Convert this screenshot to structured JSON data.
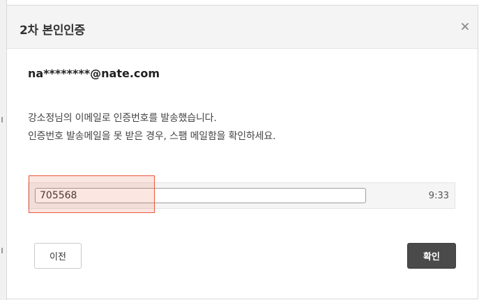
{
  "dialog": {
    "title": "2차 본인인증",
    "close_icon": "close-icon"
  },
  "account": {
    "masked_email": "na********@nate.com"
  },
  "message": {
    "line1": "강소정님의 이메일로 인증번호를 발송했습니다.",
    "line2": "인증번호 발송메일을 못 받은 경우, 스팸 메일함을 확인하세요."
  },
  "verification": {
    "code_value": "705568",
    "timer": "9:33"
  },
  "buttons": {
    "prev_label": "이전",
    "confirm_label": "확인"
  },
  "colors": {
    "header_bg": "#f4f4f4",
    "confirm_bg": "#4a4a4a",
    "highlight": "#e8553a"
  }
}
